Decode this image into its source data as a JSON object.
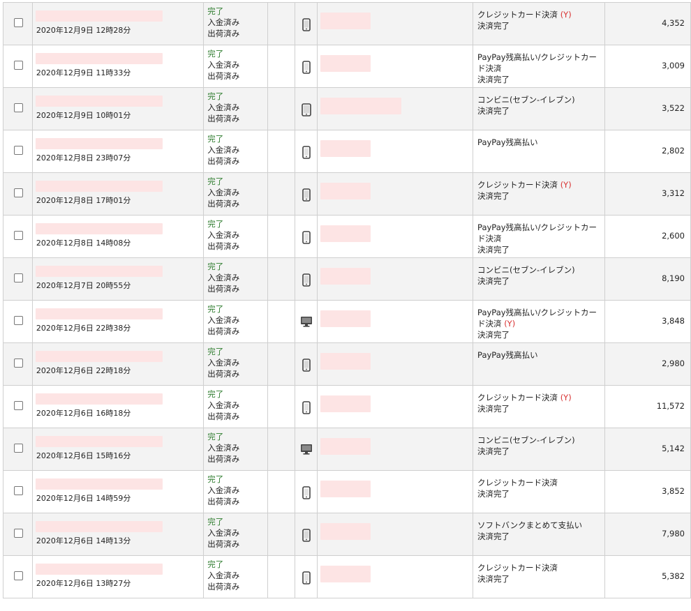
{
  "labels": {
    "status_done": "完了",
    "payment_received": "入金済み",
    "shipped": "出荷済み",
    "payment_done": "決済完了",
    "y_mark": "(Y)"
  },
  "rows": [
    {
      "date": "2020年12月9日 12時28分",
      "device": "phone",
      "payment": "クレジットカード決済",
      "ymark": true,
      "payment_done": true,
      "amount": "4,352",
      "name_w": 72
    },
    {
      "date": "2020年12月9日 11時33分",
      "device": "phone",
      "payment": "PayPay残高払い/クレジットカード決済",
      "ymark": false,
      "payment_done": true,
      "amount": "3,009",
      "name_w": 72
    },
    {
      "date": "2020年12月9日 10時01分",
      "device": "tablet",
      "payment": "コンビニ(セブン-イレブン)",
      "ymark": false,
      "payment_done": true,
      "amount": "3,522",
      "name_w": 116
    },
    {
      "date": "2020年12月8日 23時07分",
      "device": "phone",
      "payment": "PayPay残高払い",
      "ymark": false,
      "payment_done": false,
      "amount": "2,802",
      "name_w": 72
    },
    {
      "date": "2020年12月8日 17時01分",
      "device": "phone",
      "payment": "クレジットカード決済",
      "ymark": true,
      "payment_done": true,
      "amount": "3,312",
      "name_w": 72
    },
    {
      "date": "2020年12月8日 14時08分",
      "device": "phone",
      "payment": "PayPay残高払い/クレジットカード決済",
      "ymark": false,
      "payment_done": true,
      "amount": "2,600",
      "name_w": 72
    },
    {
      "date": "2020年12月7日 20時55分",
      "device": "phone",
      "payment": "コンビニ(セブン-イレブン)",
      "ymark": false,
      "payment_done": true,
      "amount": "8,190",
      "name_w": 72
    },
    {
      "date": "2020年12月6日 22時38分",
      "device": "desktop",
      "payment": "PayPay残高払い/クレジットカード決済",
      "ymark": true,
      "payment_done": true,
      "amount": "3,848",
      "name_w": 72
    },
    {
      "date": "2020年12月6日 22時18分",
      "device": "phone",
      "payment": "PayPay残高払い",
      "ymark": false,
      "payment_done": false,
      "amount": "2,980",
      "name_w": 72
    },
    {
      "date": "2020年12月6日 16時18分",
      "device": "phone",
      "payment": "クレジットカード決済",
      "ymark": true,
      "payment_done": true,
      "amount": "11,572",
      "name_w": 72
    },
    {
      "date": "2020年12月6日 15時16分",
      "device": "desktop",
      "payment": "コンビニ(セブン-イレブン)",
      "ymark": false,
      "payment_done": true,
      "amount": "5,142",
      "name_w": 72
    },
    {
      "date": "2020年12月6日 14時59分",
      "device": "phone",
      "payment": "クレジットカード決済",
      "ymark": false,
      "payment_done": true,
      "amount": "3,852",
      "name_w": 72
    },
    {
      "date": "2020年12月6日 14時13分",
      "device": "phone",
      "payment": "ソフトバンクまとめて支払い",
      "ymark": false,
      "payment_done": true,
      "amount": "7,980",
      "name_w": 72
    },
    {
      "date": "2020年12月6日 13時27分",
      "device": "phone",
      "payment": "クレジットカード決済",
      "ymark": false,
      "payment_done": true,
      "amount": "5,382",
      "name_w": 72
    }
  ]
}
